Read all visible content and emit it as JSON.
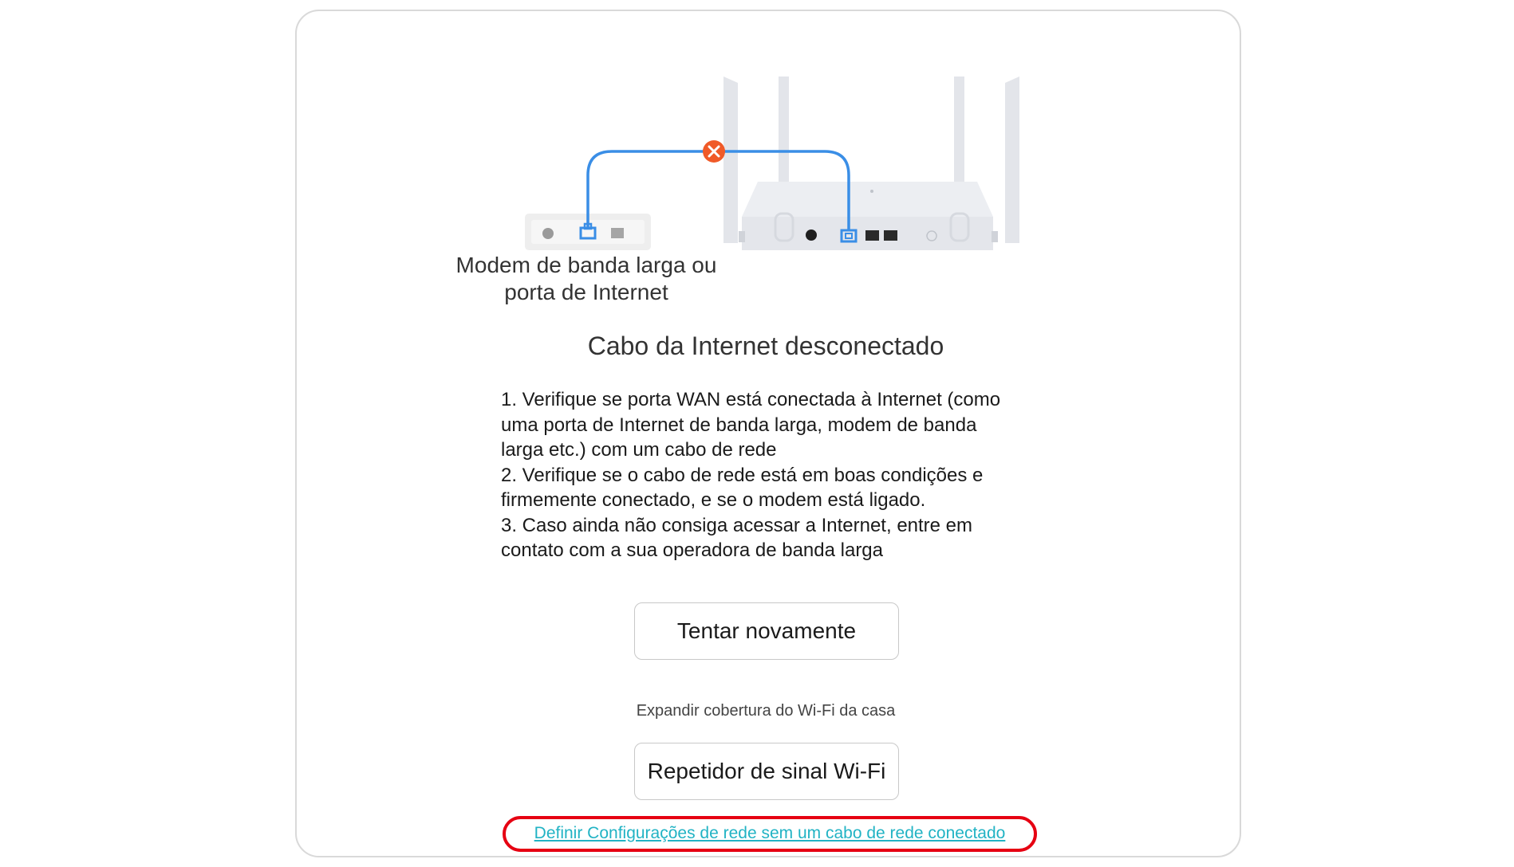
{
  "illustration": {
    "modem_label_line1": "Modem de banda larga ou",
    "modem_label_line2": "porta de Internet",
    "error_icon": "x-circle-icon",
    "cable_color": "#3a8ee6",
    "error_color": "#f05a28"
  },
  "status": {
    "title": "Cabo da Internet desconectado"
  },
  "instructions": {
    "lines": [
      "1. Verifique se porta WAN está conectada à Internet (como",
      "uma porta de Internet de banda larga, modem de banda",
      "larga etc.) com um cabo de rede",
      "2. Verifique se o cabo de rede está em boas condições e",
      "firmemente conectado, e se o modem está ligado.",
      "3. Caso ainda não consiga acessar a Internet, entre em",
      "contato com a sua operadora de banda larga"
    ]
  },
  "actions": {
    "retry_label": "Tentar novamente",
    "expand_text": "Expandir cobertura do Wi-Fi da casa",
    "repeater_label": "Repetidor de sinal Wi-Fi",
    "setup_link": "Definir Configurações de rede sem um cabo de rede conectado"
  },
  "colors": {
    "link": "#21b3c4",
    "highlight": "#e60012"
  }
}
